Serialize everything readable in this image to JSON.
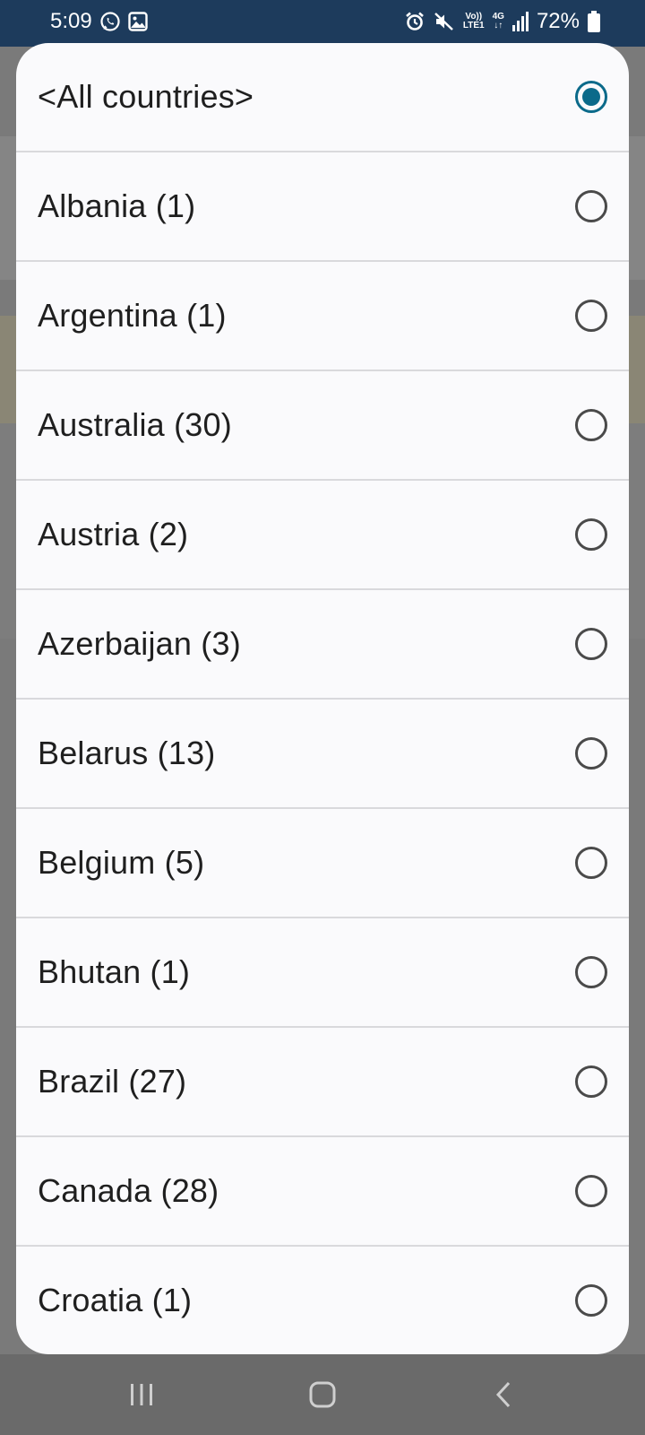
{
  "status_bar": {
    "time": "5:09",
    "battery_percent": "72%",
    "network_label_top": "Vo))",
    "network_label_bottom": "LTE1",
    "network_type": "4G",
    "icons": [
      "whatsapp-icon",
      "gallery-icon",
      "alarm-icon",
      "mute-icon",
      "signal-icon",
      "battery-icon"
    ]
  },
  "dialog": {
    "selected_index": 0,
    "options": [
      {
        "label": "<All countries>",
        "selected": true
      },
      {
        "label": "Albania (1)",
        "selected": false
      },
      {
        "label": "Argentina (1)",
        "selected": false
      },
      {
        "label": "Australia (30)",
        "selected": false
      },
      {
        "label": "Austria (2)",
        "selected": false
      },
      {
        "label": "Azerbaijan (3)",
        "selected": false
      },
      {
        "label": "Belarus (13)",
        "selected": false
      },
      {
        "label": "Belgium (5)",
        "selected": false
      },
      {
        "label": "Bhutan (1)",
        "selected": false
      },
      {
        "label": "Brazil (27)",
        "selected": false
      },
      {
        "label": "Canada (28)",
        "selected": false
      },
      {
        "label": "Croatia (1)",
        "selected": false
      }
    ]
  },
  "colors": {
    "accent": "#0b6a8a",
    "status_bar_bg": "#1d3b5c",
    "dialog_bg": "#fafafc",
    "scrim": "#6a6a6a"
  },
  "nav_bar": {
    "buttons": [
      "recent-apps-icon",
      "home-icon",
      "back-icon"
    ]
  }
}
